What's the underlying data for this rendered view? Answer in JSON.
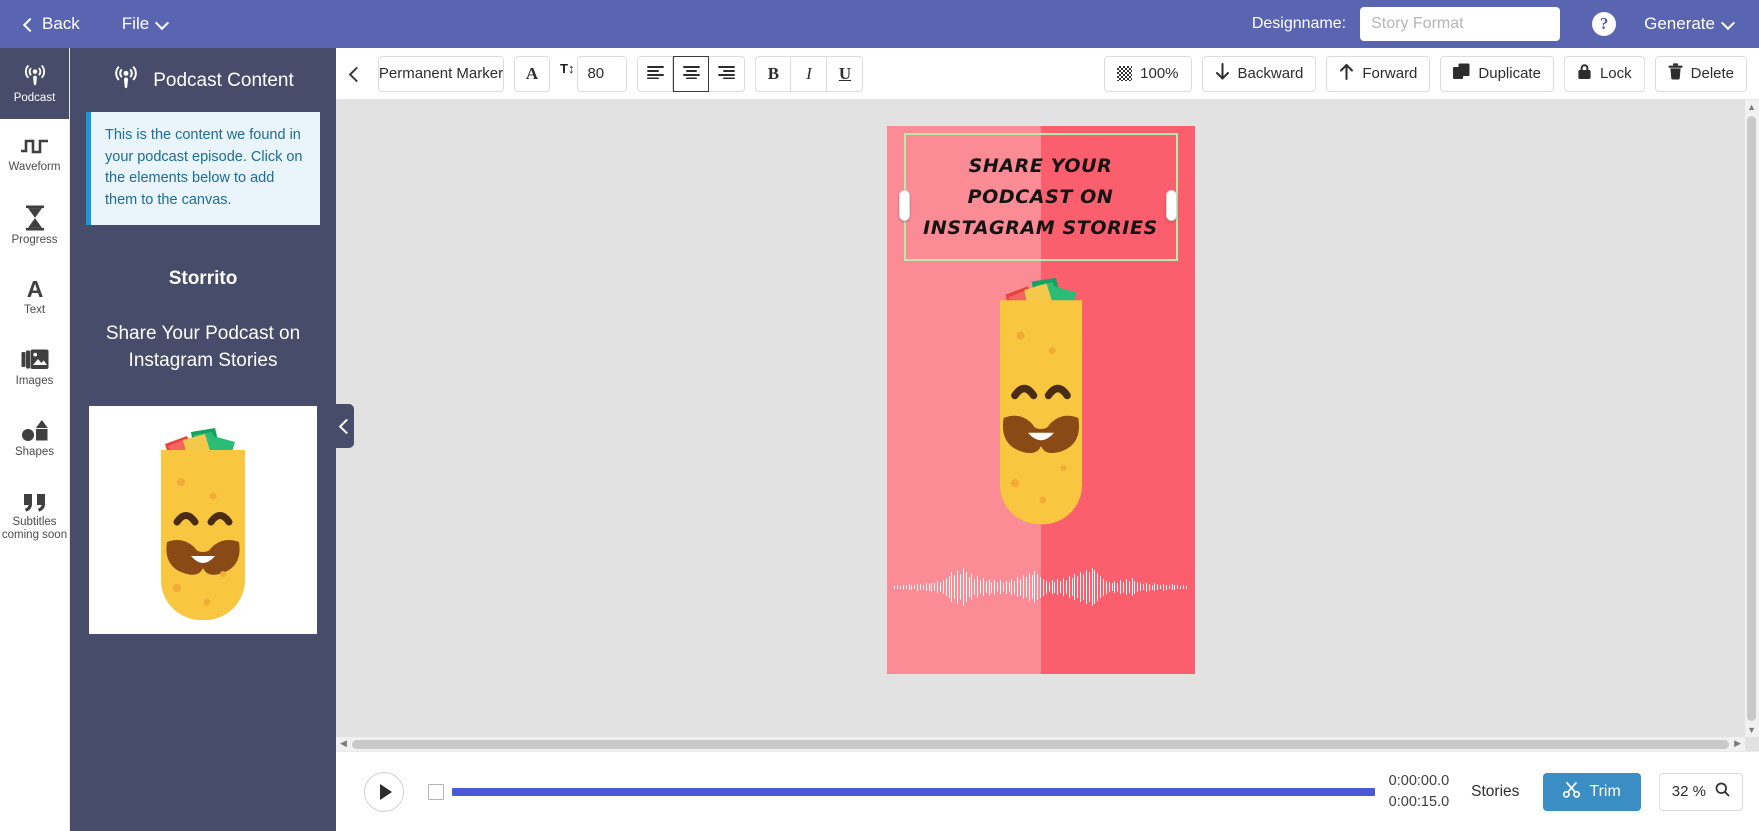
{
  "topbar": {
    "back_label": "Back",
    "file_label": "File",
    "designname_label": "Designname:",
    "designname_value": "",
    "designname_placeholder": "Story Format",
    "help_glyph": "?",
    "generate_label": "Generate",
    "bg_color": "#5965b0"
  },
  "rail": {
    "items": [
      {
        "label": "Podcast",
        "icon": "podcast-icon",
        "active": true
      },
      {
        "label": "Waveform",
        "icon": "waveform-icon",
        "active": false
      },
      {
        "label": "Progress",
        "icon": "hourglass-icon",
        "active": false
      },
      {
        "label": "Text",
        "icon": "text-a-icon",
        "active": false
      },
      {
        "label": "Images",
        "icon": "images-icon",
        "active": false
      },
      {
        "label": "Shapes",
        "icon": "shapes-icon",
        "active": false
      },
      {
        "label": "Subtitles coming soon",
        "icon": "quote-icon",
        "active": false
      }
    ]
  },
  "panel": {
    "header_title": "Podcast Content",
    "header_icon": "podcast-icon",
    "alert_text": "This is the content we found in your podcast episode. Click on the elements below to add them to the canvas.",
    "alert_accent": "#1c97d6",
    "podcast_name": "Storrito",
    "episode_title": "Share Your Podcast on Instagram Stories",
    "thumbnail_alt": "burrito-artwork",
    "bg_color": "#464c69"
  },
  "toolbar": {
    "collapse_icon": "chevron-left-icon",
    "font_family": "Permanent Marker",
    "text_color_label": "A",
    "font_size_icon": "T↕",
    "font_size": "80",
    "align_left": "align-left-icon",
    "align_center": "align-center-icon",
    "align_right": "align-right-icon",
    "align_selected": "center",
    "bold": "B",
    "italic": "I",
    "underline": "U",
    "opacity_label": "100%",
    "backward_label": "Backward",
    "forward_label": "Forward",
    "duplicate_label": "Duplicate",
    "lock_label": "Lock",
    "delete_label": "Delete"
  },
  "canvas": {
    "title_lines": [
      "Share your",
      "Podcast on",
      "Instagram Stories"
    ],
    "selection_color": "#b5ecaa",
    "bg_left": "#fb8b95",
    "bg_right": "#fb5f6d",
    "waveform_color": "#ffffff"
  },
  "player": {
    "play_icon": "play-icon",
    "time_current": "0:00:00.0",
    "time_total": "0:00:15.0",
    "format_label": "Stories",
    "trim_label": "Trim",
    "trim_icon": "scissors-icon",
    "trim_color": "#3a8ec4",
    "zoom_level": "32 %",
    "zoom_icon": "magnifier-icon",
    "track_color": "#4a59d6"
  }
}
